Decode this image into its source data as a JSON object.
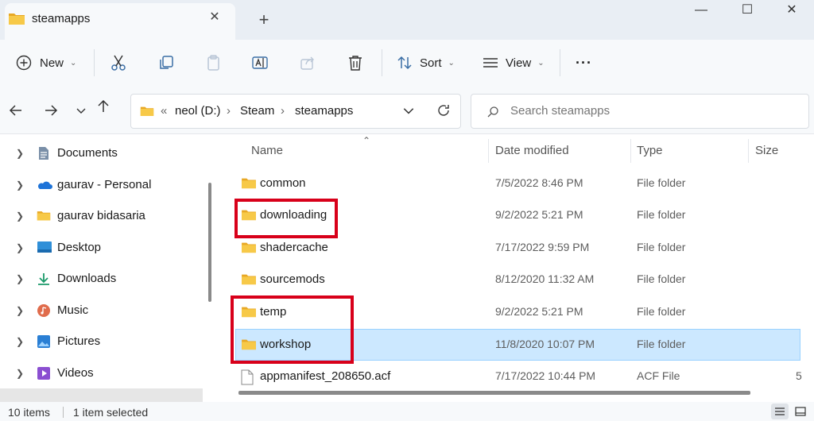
{
  "window": {
    "tab_title": "steamapps",
    "new_tab_glyph": "+",
    "tab_close_glyph": "✕",
    "min_glyph": "—",
    "max_glyph": "☐",
    "close_glyph": "✕"
  },
  "toolbar": {
    "new_label": "New",
    "sort_label": "Sort",
    "view_label": "View",
    "more_glyph": "···"
  },
  "address": {
    "overflow": "«",
    "crumbs": [
      "neol (D:)",
      "Steam",
      "steamapps"
    ],
    "sep": "›"
  },
  "search": {
    "placeholder": "Search steamapps"
  },
  "nav": {
    "items": [
      {
        "label": "Documents",
        "icon": "documents-icon"
      },
      {
        "label": "gaurav - Personal",
        "icon": "onedrive-icon"
      },
      {
        "label": "gaurav bidasaria",
        "icon": "folder-icon"
      },
      {
        "label": "Desktop",
        "icon": "desktop-icon"
      },
      {
        "label": "Downloads",
        "icon": "downloads-icon"
      },
      {
        "label": "Music",
        "icon": "music-icon"
      },
      {
        "label": "Pictures",
        "icon": "pictures-icon"
      },
      {
        "label": "Videos",
        "icon": "videos-icon"
      }
    ]
  },
  "columns": {
    "name": "Name",
    "date": "Date modified",
    "type": "Type",
    "size": "Size"
  },
  "files": [
    {
      "name": "common",
      "date": "7/5/2022 8:46 PM",
      "type": "File folder",
      "size": ""
    },
    {
      "name": "downloading",
      "date": "9/2/2022 5:21 PM",
      "type": "File folder",
      "size": ""
    },
    {
      "name": "shadercache",
      "date": "7/17/2022 9:59 PM",
      "type": "File folder",
      "size": ""
    },
    {
      "name": "sourcemods",
      "date": "8/12/2020 11:32 AM",
      "type": "File folder",
      "size": ""
    },
    {
      "name": "temp",
      "date": "9/2/2022 5:21 PM",
      "type": "File folder",
      "size": ""
    },
    {
      "name": "workshop",
      "date": "11/8/2020 10:07 PM",
      "type": "File folder",
      "size": ""
    },
    {
      "name": "appmanifest_208650.acf",
      "date": "7/17/2022 10:44 PM",
      "type": "ACF File",
      "size": "5"
    }
  ],
  "status": {
    "count": "10 items",
    "selected": "1 item selected"
  },
  "colors": {
    "folder": "#f5c342",
    "selection": "#cce8ff",
    "highlight": "#d8001a"
  }
}
